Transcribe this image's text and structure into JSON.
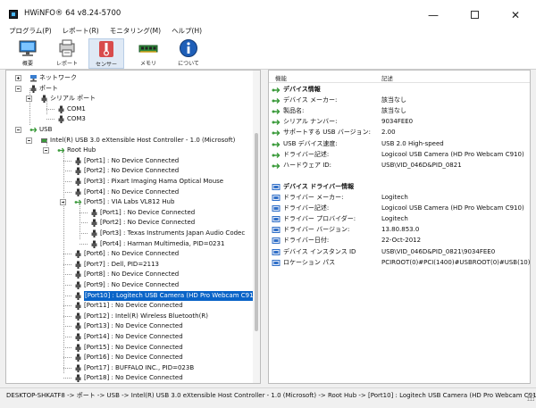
{
  "window": {
    "title": "HWiNFO® 64 v8.24-5700",
    "minimize_glyph": "—",
    "close_glyph": "✕"
  },
  "menu": [
    "プログラム(P)",
    "レポート(R)",
    "モニタリング(M)",
    "ヘルプ(H)"
  ],
  "toolbar": [
    {
      "label": "概要",
      "icon": "monitor-icon"
    },
    {
      "label": "レポート",
      "icon": "report-icon"
    },
    {
      "label": "センサー",
      "icon": "thermometer-icon"
    },
    {
      "label": "メモリ",
      "icon": "memory-icon"
    },
    {
      "label": "について",
      "icon": "info-icon"
    }
  ],
  "tree": [
    {
      "text": "ネットワーク",
      "depth": 0,
      "icon": "network",
      "expander": "plus"
    },
    {
      "text": "ポート",
      "depth": 0,
      "icon": "port",
      "expander": "minus"
    },
    {
      "text": "シリアル ポート",
      "depth": 1,
      "icon": "port",
      "expander": "minus"
    },
    {
      "text": "COM1",
      "depth": 2,
      "icon": "port"
    },
    {
      "text": "COM3",
      "depth": 2,
      "icon": "port"
    },
    {
      "text": "USB",
      "depth": 0,
      "icon": "usb",
      "expander": "minus"
    },
    {
      "text": "Intel(R) USB 3.0 eXtensible Host Controller - 1.0 (Microsoft)",
      "depth": 1,
      "icon": "controller",
      "expander": "minus"
    },
    {
      "text": "Root Hub",
      "depth": 2,
      "icon": "usb",
      "expander": "minus"
    },
    {
      "text": "[Port1] : No Device Connected",
      "depth": 3,
      "icon": "port"
    },
    {
      "text": "[Port2] : No Device Connected",
      "depth": 3,
      "icon": "port"
    },
    {
      "text": "[Port3] : Pixart Imaging Hama Optical Mouse",
      "depth": 3,
      "icon": "port"
    },
    {
      "text": "[Port4] : No Device Connected",
      "depth": 3,
      "icon": "port"
    },
    {
      "text": "[Port5] : VIA Labs VL812 Hub",
      "depth": 3,
      "icon": "usb",
      "expander": "minus"
    },
    {
      "text": "[Port1] : No Device Connected",
      "depth": 4,
      "icon": "port"
    },
    {
      "text": "[Port2] : No Device Connected",
      "depth": 4,
      "icon": "port"
    },
    {
      "text": "[Port3] : Texas Instruments Japan Audio Codec",
      "depth": 4,
      "icon": "port"
    },
    {
      "text": "[Port4] : Harman Multimedia, PID=0231",
      "depth": 4,
      "icon": "port"
    },
    {
      "text": "[Port6] : No Device Connected",
      "depth": 3,
      "icon": "port"
    },
    {
      "text": "[Port7] : Dell, PID=2113",
      "depth": 3,
      "icon": "port"
    },
    {
      "text": "[Port8] : No Device Connected",
      "depth": 3,
      "icon": "port"
    },
    {
      "text": "[Port9] : No Device Connected",
      "depth": 3,
      "icon": "port"
    },
    {
      "text": "[Port10] : Logitech USB Camera (HD Pro Webcam C910)",
      "depth": 3,
      "icon": "port",
      "selected": true
    },
    {
      "text": "[Port11] : No Device Connected",
      "depth": 3,
      "icon": "port"
    },
    {
      "text": "[Port12] : Intel(R) Wireless Bluetooth(R)",
      "depth": 3,
      "icon": "port"
    },
    {
      "text": "[Port13] : No Device Connected",
      "depth": 3,
      "icon": "port"
    },
    {
      "text": "[Port14] : No Device Connected",
      "depth": 3,
      "icon": "port"
    },
    {
      "text": "[Port15] : No Device Connected",
      "depth": 3,
      "icon": "port"
    },
    {
      "text": "[Port16] : No Device Connected",
      "depth": 3,
      "icon": "port"
    },
    {
      "text": "[Port17] : BUFFALO INC., PID=023B",
      "depth": 3,
      "icon": "port"
    },
    {
      "text": "[Port18] : No Device Connected",
      "depth": 3,
      "icon": "port"
    }
  ],
  "details": {
    "col_feature": "機能",
    "col_description": "記述",
    "rows": [
      {
        "label": "デバイス情報",
        "section": true,
        "icon": "usb"
      },
      {
        "label": "デバイス メーカー:",
        "value": "該当なし",
        "icon": "usb"
      },
      {
        "label": "製品名:",
        "value": "該当なし",
        "icon": "usb"
      },
      {
        "label": "シリアル ナンバー:",
        "value": "9034FEE0",
        "icon": "usb"
      },
      {
        "label": "サポートする USB バージョン:",
        "value": "2.00",
        "icon": "usb"
      },
      {
        "label": "USB デバイス速度:",
        "value": "USB 2.0 High-speed",
        "icon": "usb"
      },
      {
        "label": "ドライバー記述:",
        "value": "Logicool USB Camera (HD Pro Webcam C910)",
        "icon": "usb"
      },
      {
        "label": "ハードウェア ID:",
        "value": "USB\\VID_046D&PID_0821",
        "icon": "usb"
      },
      {
        "label": "",
        "value": "",
        "icon": ""
      },
      {
        "label": "デバイス ドライバー情報",
        "section": true,
        "icon": "driver"
      },
      {
        "label": "ドライバー メーカー:",
        "value": "Logitech",
        "icon": "driver"
      },
      {
        "label": "ドライバー記述:",
        "value": "Logicool USB Camera (HD Pro Webcam C910)",
        "icon": "driver"
      },
      {
        "label": "ドライバー プロバイダー:",
        "value": "Logitech",
        "icon": "driver"
      },
      {
        "label": "ドライバー バージョン:",
        "value": "13.80.853.0",
        "icon": "driver"
      },
      {
        "label": "ドライバー日付:",
        "value": "22-Oct-2012",
        "icon": "driver"
      },
      {
        "label": "デバイス インスタンス ID",
        "value": "USB\\VID_046D&PID_0821\\9034FEE0",
        "icon": "driver"
      },
      {
        "label": "ロケーション パス",
        "value": "PCIROOT(0)#PCI(1400)#USBROOT(0)#USB(10)",
        "icon": "driver"
      }
    ]
  },
  "status": "DESKTOP-SHKATF8 -> ポート -> USB -> Intel(R) USB 3.0 eXtensible Host Controller - 1.0 (Microsoft) -> Root Hub -> [Port10] : Logitech USB Camera (HD Pro Webcam C910)",
  "colors": {
    "selection": "#0a64c8",
    "usb_green": "#3a9a3a",
    "driver_blue": "#2f6fc8"
  }
}
